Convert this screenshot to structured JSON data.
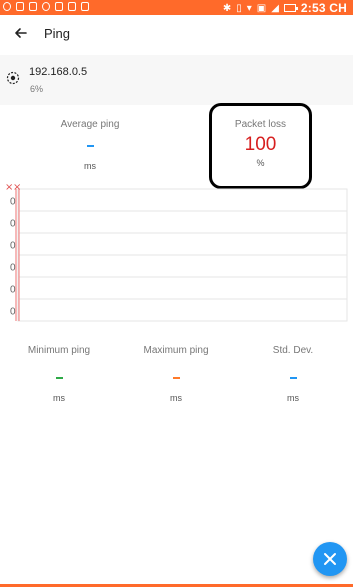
{
  "status_bar": {
    "time": "2:53 CH",
    "left_icons": [
      "app-icon-1",
      "app-icon-2",
      "image-icon",
      "gear-icon",
      "youtube-icon",
      "bag-icon",
      "mail-icon"
    ],
    "right_icons": [
      "bluetooth-icon",
      "vibrate-icon",
      "wifi-icon",
      "sim-icon",
      "signal-icon",
      "battery-icon"
    ]
  },
  "appbar": {
    "title": "Ping"
  },
  "host": {
    "ip": "192.168.0.5",
    "percent": "6%"
  },
  "stats": {
    "average_ping": {
      "label": "Average ping",
      "value": "-",
      "unit": "ms",
      "color": "#2196f3"
    },
    "packet_loss": {
      "label": "Packet loss",
      "value": "100",
      "unit": "%",
      "color": "#d71f1f"
    },
    "minimum_ping": {
      "label": "Minimum ping",
      "value": "-",
      "unit": "ms",
      "color": "#2eaa47"
    },
    "maximum_ping": {
      "label": "Maximum ping",
      "value": "-",
      "unit": "ms",
      "color": "#ff7a2a"
    },
    "std_dev": {
      "label": "Std. Dev.",
      "value": "-",
      "unit": "ms",
      "color": "#2196f3"
    }
  },
  "chart_data": {
    "type": "line",
    "title": "",
    "y_tick_labels": [
      "0",
      "0",
      "0",
      "0",
      "0",
      "0"
    ],
    "series": [],
    "failed_marks": [
      "×",
      "×"
    ],
    "grid": true
  },
  "accent": {
    "brand": "#ff6a2a",
    "fab": "#2196f3"
  }
}
